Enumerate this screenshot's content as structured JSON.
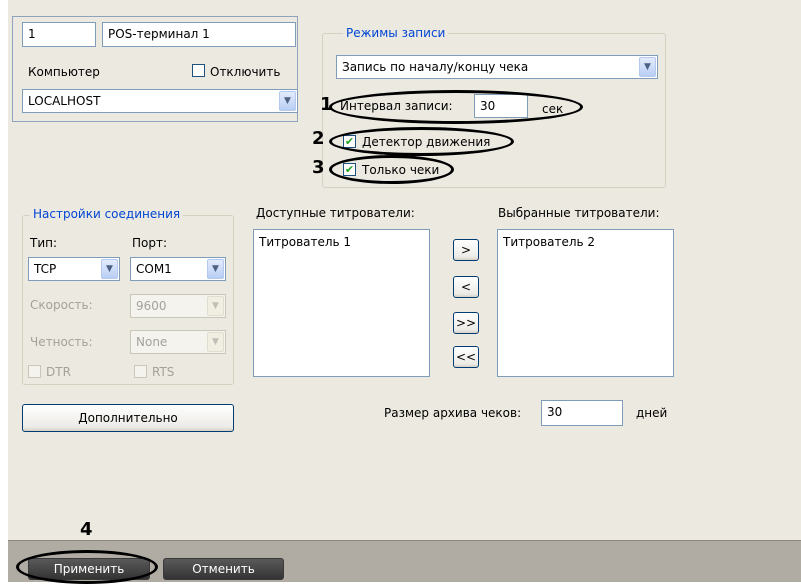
{
  "terminal": {
    "id": "1",
    "name": "POS-терминал 1",
    "computer_label": "Компьютер",
    "disable_label": "Отключить",
    "computer_value": "LOCALHOST"
  },
  "record_modes": {
    "title": "Режимы записи",
    "mode_value": "Запись по началу/концу чека",
    "interval_label": "Интервал записи:",
    "interval_value": "30",
    "interval_unit": "сек",
    "motion_label": "Детектор движения",
    "motion_checked": true,
    "receipts_label": "Только чеки",
    "receipts_checked": true
  },
  "connection": {
    "title": "Настройки соединения",
    "type_label": "Тип:",
    "port_label": "Порт:",
    "type_value": "TCP",
    "port_value": "COM1",
    "speed_label": "Скорость:",
    "speed_value": "9600",
    "parity_label": "Четность:",
    "parity_value": "None",
    "dtr_label": "DTR",
    "rts_label": "RTS"
  },
  "titlers": {
    "available_label": "Доступные титрователи:",
    "selected_label": "Выбранные титрователи:",
    "available_items": [
      "Титрователь 1"
    ],
    "selected_items": [
      "Титрователь 2"
    ],
    "btn_add": ">",
    "btn_remove": "<",
    "btn_add_all": ">>",
    "btn_remove_all": "<<"
  },
  "advanced_button": "Дополнительно",
  "archive": {
    "label": "Размер архива чеков:",
    "value": "30",
    "unit": "дней"
  },
  "footer": {
    "apply": "Применить",
    "cancel": "Отменить"
  },
  "callouts": [
    "1",
    "2",
    "3",
    "4"
  ]
}
